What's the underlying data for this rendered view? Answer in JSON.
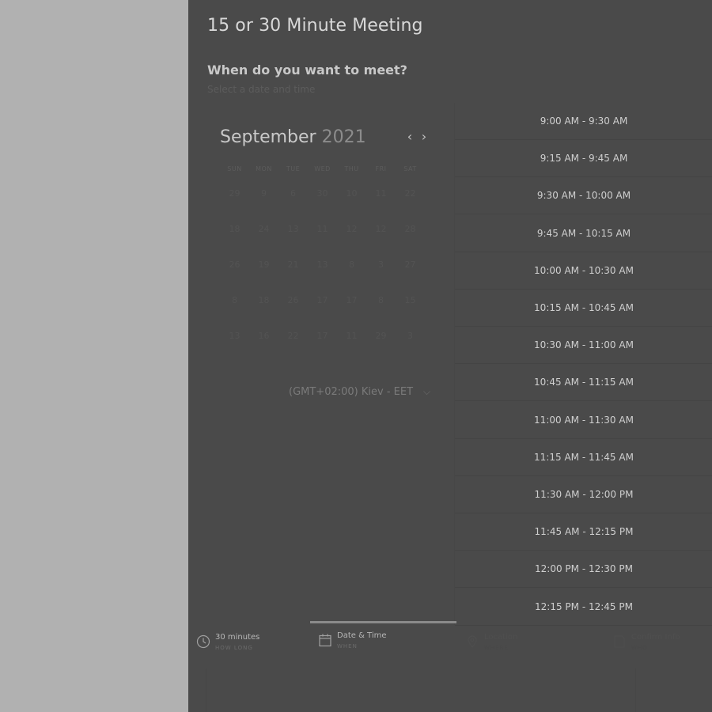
{
  "title": "15 or 30 Minute Meeting",
  "heading": "When do you want to meet?",
  "subheading": "Select a date and time",
  "calendar": {
    "month": "September",
    "year": "2021",
    "prev_icon": "‹",
    "next_icon": "›",
    "weekdays": [
      "SUN",
      "MON",
      "TUE",
      "WED",
      "THU",
      "FRI",
      "SAT"
    ],
    "days": [
      "29",
      "9",
      "6",
      "30",
      "10",
      "11",
      "22",
      "18",
      "24",
      "13",
      "11",
      "12",
      "12",
      "28",
      "26",
      "19",
      "21",
      "13",
      "8",
      "3",
      "27",
      "8",
      "18",
      "26",
      "17",
      "17",
      "8",
      "15",
      "13",
      "16",
      "22",
      "17",
      "11",
      "29",
      "3"
    ]
  },
  "timezone": {
    "label": "(GMT+02:00) Kiev - EET",
    "chevron": "⌵"
  },
  "time_slots": [
    "9:00 AM - 9:30 AM",
    "9:15 AM - 9:45 AM",
    "9:30 AM - 10:00 AM",
    "9:45 AM - 10:15 AM",
    "10:00 AM - 10:30 AM",
    "10:15 AM - 10:45 AM",
    "10:30 AM - 11:00 AM",
    "10:45 AM - 11:15 AM",
    "11:00 AM - 11:30 AM",
    "11:15 AM - 11:45 AM",
    "11:30 AM - 12:00 PM",
    "11:45 AM - 12:15 PM",
    "12:00 PM - 12:30 PM",
    "12:15 PM - 12:45 PM"
  ],
  "steps": [
    {
      "label": "30 minutes",
      "sub": "HOW LONG",
      "icon": "clock-icon",
      "state": "on"
    },
    {
      "label": "Date & Time",
      "sub": "WHEN",
      "icon": "calendar-icon",
      "state": "on",
      "active": true
    },
    {
      "label": "Location",
      "sub": "WHERE",
      "icon": "location-pin-icon",
      "state": "off"
    },
    {
      "label": "Confirm Info",
      "sub": "WHO",
      "icon": "document-icon",
      "state": "off"
    }
  ],
  "colors": {
    "panel_background": "#4a4a4a",
    "page_background": "#b1b1b1"
  }
}
